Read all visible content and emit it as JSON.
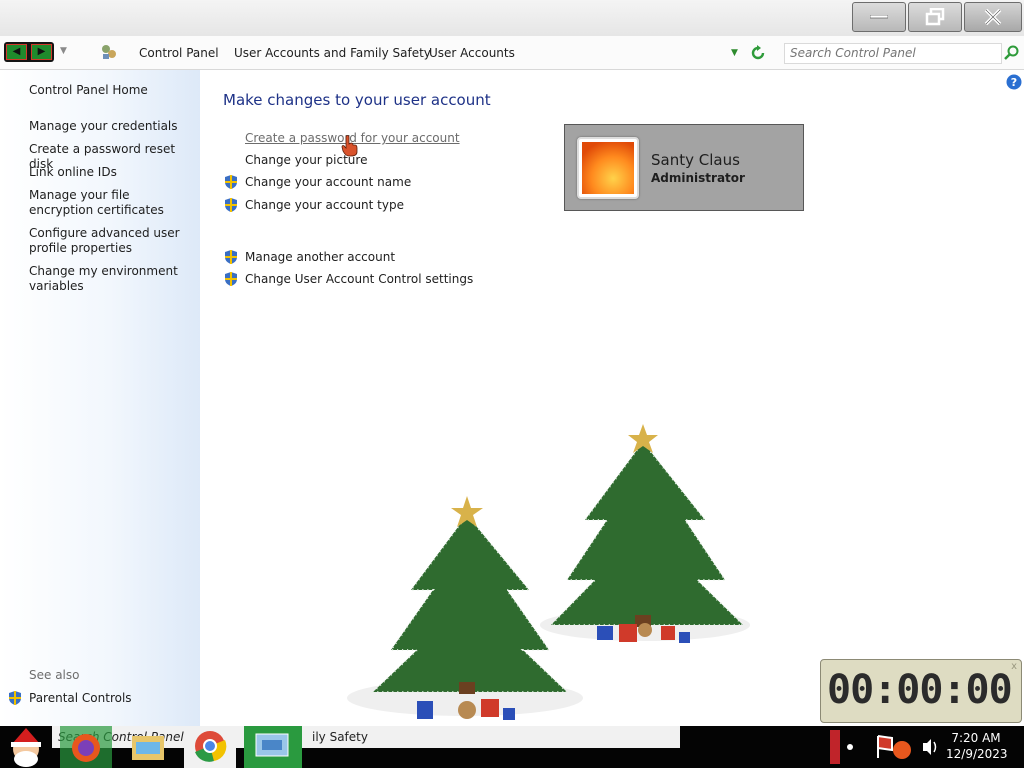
{
  "window": {
    "minimize_label": "minimize",
    "maximize_label": "restore",
    "close_label": "close"
  },
  "address": {
    "breadcrumbs": [
      "Control Panel",
      "User Accounts and Family Safety",
      "User Accounts"
    ],
    "search_placeholder": "Search Control Panel"
  },
  "sidebar": {
    "home": "Control Panel Home",
    "links": [
      "Manage your credentials",
      "Create a password reset disk",
      "Link online IDs",
      "Manage your file encryption certificates",
      "Configure advanced user profile properties",
      "Change my environment variables"
    ],
    "see_also": "See also",
    "parental_controls": "Parental Controls"
  },
  "main": {
    "heading": "Make changes to your user account",
    "tasks": [
      "Create a password for your account",
      "Change your picture",
      "Change your account name",
      "Change your account type"
    ],
    "other_tasks": [
      "Manage another account",
      "Change User Account Control settings"
    ]
  },
  "account": {
    "name": "Santy Claus",
    "role": "Administrator"
  },
  "clock_widget": {
    "display": "00:00:00",
    "close": "x"
  },
  "taskbar": {
    "window_title_1": "Search Control Panel",
    "window_title_2": "ily Safety",
    "time": "7:20 AM",
    "date": "12/9/2023"
  },
  "colors": {
    "heading": "#1e3287",
    "account_tile": "#a3a3a3",
    "sidebar_gradient_end": "#dde9f8"
  }
}
